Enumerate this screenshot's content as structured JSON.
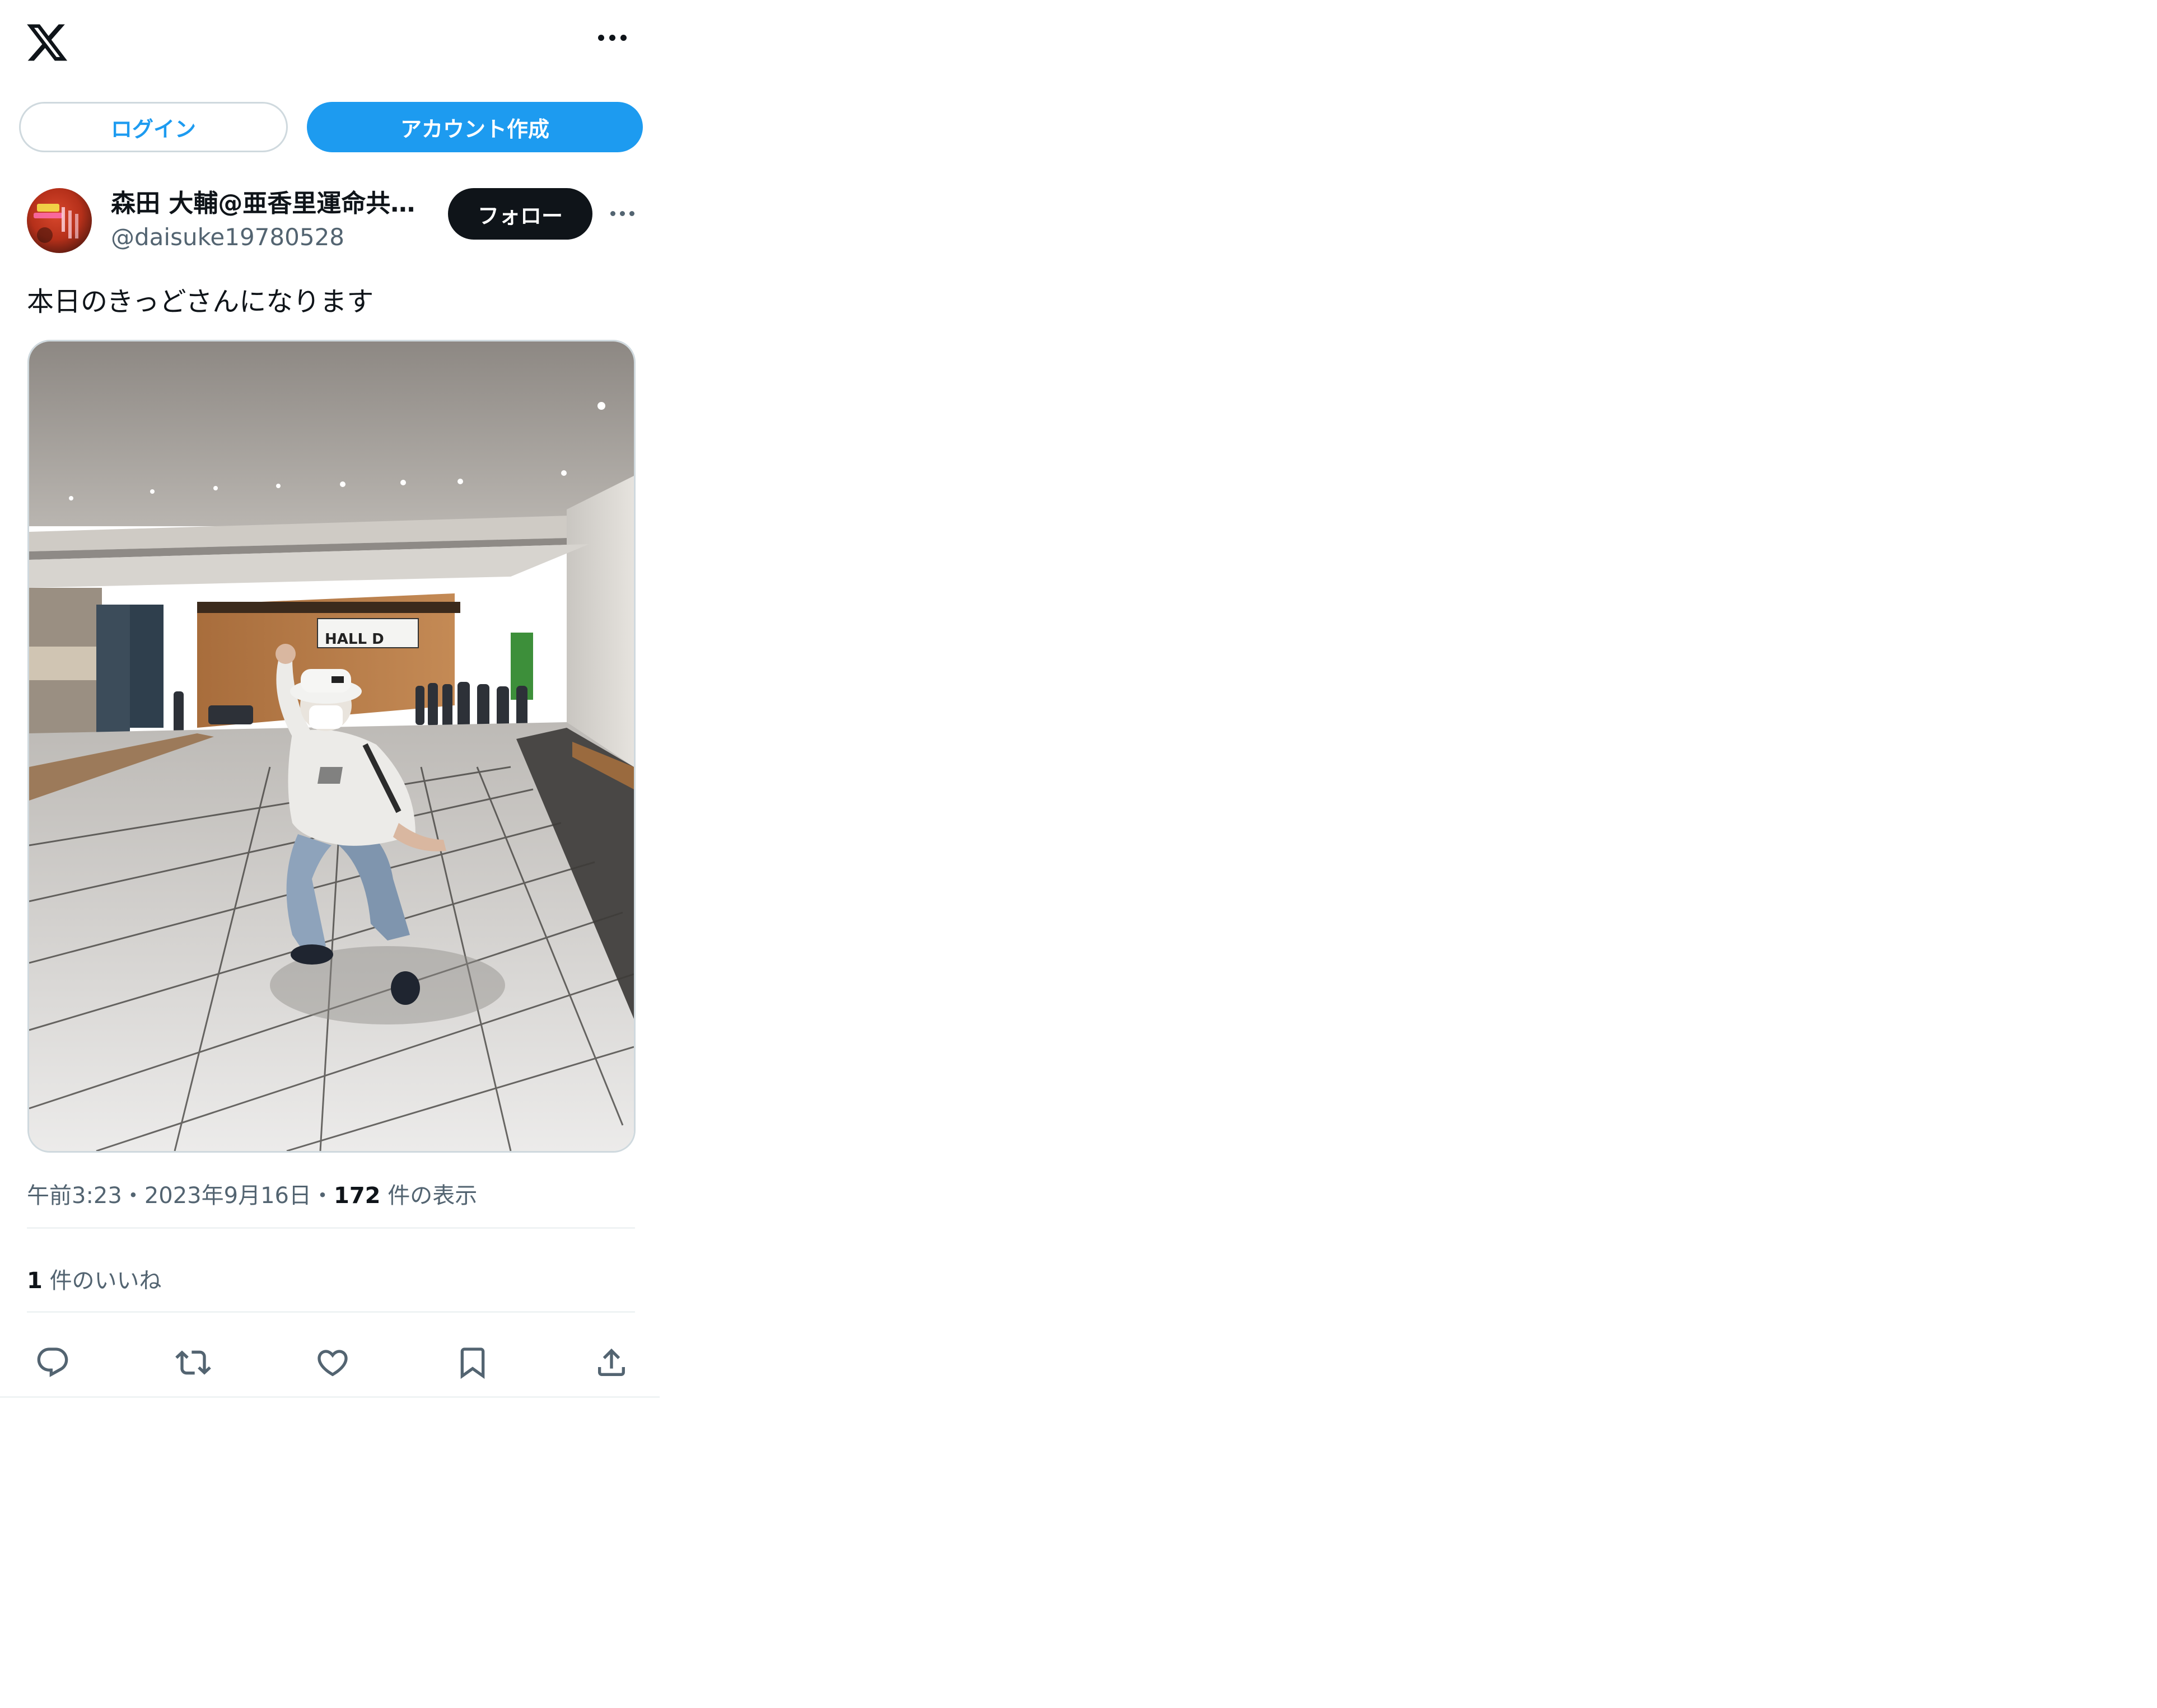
{
  "header": {
    "logo_icon": "x-logo-icon",
    "more_icon": "more-horizontal-icon"
  },
  "auth": {
    "login_label": "ログイン",
    "signup_label": "アカウント作成"
  },
  "tweet": {
    "display_name": "森田 大輔@亜香里運命共同体",
    "handle": "@daisuke19780528",
    "follow_label": "フォロー",
    "text": "本日のきっどさんになります",
    "time": "午前3:23",
    "separator1": "・",
    "date": "2023年9月16日",
    "separator2": "・",
    "views_count": "172",
    "views_label": "件の表示",
    "likes_count": "1",
    "likes_label": "件のいいね",
    "image_sign_text": "HALL D"
  },
  "actions": {
    "items": [
      "reply-icon",
      "retweet-icon",
      "like-icon",
      "bookmark-icon",
      "share-icon"
    ]
  },
  "colors": {
    "accent": "#1d9bf0",
    "text": "#0f1419",
    "secondary": "#536471",
    "border": "#cfd9de"
  }
}
